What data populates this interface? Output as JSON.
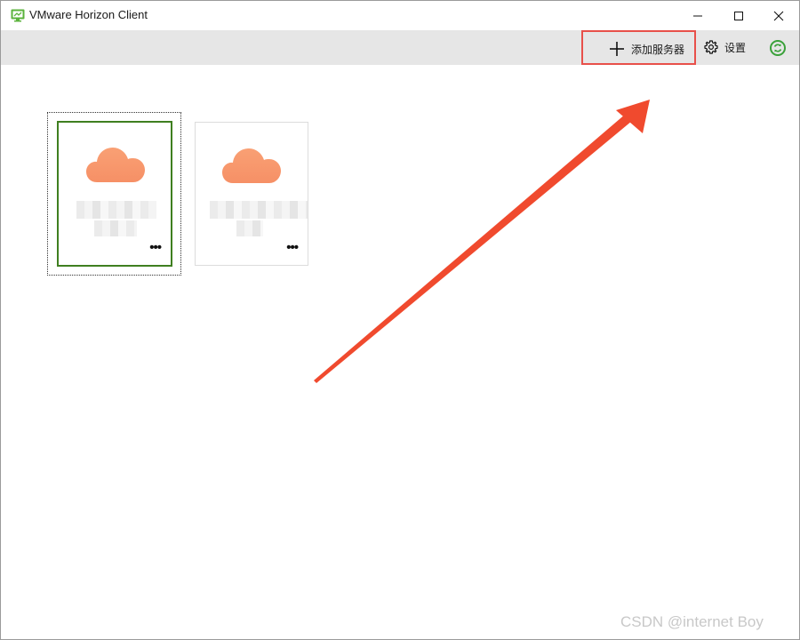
{
  "window": {
    "title": "VMware Horizon Client"
  },
  "toolbar": {
    "add_server_label": "添加服务器",
    "settings_label": "设置"
  },
  "colors": {
    "accent_green": "#3f7f20",
    "cloud_orange": "#f7996a",
    "highlight_red": "#e8504a",
    "toolbar_bg": "#e6e6e6"
  },
  "icons": [
    "app-icon",
    "minimize-icon",
    "maximize-icon",
    "close-icon",
    "plus-icon",
    "gear-icon",
    "refresh-icon",
    "cloud-icon",
    "more-icon"
  ],
  "servers": [
    {
      "more_label": "•••"
    },
    {
      "more_label": "•••"
    }
  ],
  "watermark": "CSDN @internet  Boy"
}
